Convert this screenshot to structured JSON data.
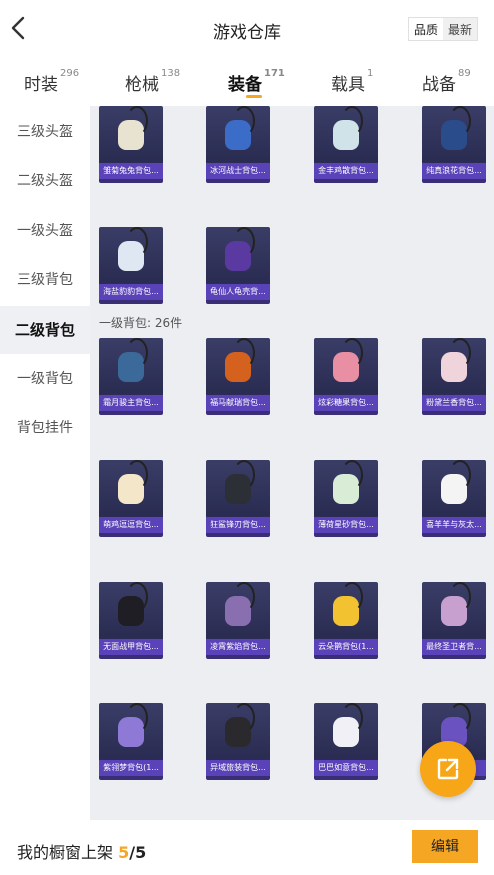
{
  "header": {
    "title": "游戏仓库",
    "sort_quality": "品质",
    "sort_newest": "最新"
  },
  "tabs": [
    {
      "label": "时装",
      "count": "296"
    },
    {
      "label": "枪械",
      "count": "138"
    },
    {
      "label": "装备",
      "count": "171"
    },
    {
      "label": "载具",
      "count": "1"
    },
    {
      "label": "战备",
      "count": "89"
    }
  ],
  "active_tab": "装备",
  "sidebar": [
    {
      "label": "三级头盔"
    },
    {
      "label": "二级头盔"
    },
    {
      "label": "一级头盔"
    },
    {
      "label": "三级背包"
    },
    {
      "label": "二级背包"
    },
    {
      "label": "一级背包"
    },
    {
      "label": "背包挂件"
    }
  ],
  "active_sidebar": "二级背包",
  "section_level1": {
    "label": "一级背包: 26件"
  },
  "items_top": [
    {
      "name": "雏菊兔兔背包...",
      "color": "#e8e3d0"
    },
    {
      "name": "冰河战士背包...",
      "color": "#3a6cc8"
    },
    {
      "name": "金丰鸡散背包...",
      "color": "#cfe3e8"
    },
    {
      "name": "纯真浪花背包...",
      "color": "#2a4c8a"
    },
    {
      "name": "海盐豹豹背包...",
      "color": "#dfe8f2"
    },
    {
      "name": "龟仙人龟壳背...",
      "color": "#5a3aa0"
    }
  ],
  "items_level1": [
    {
      "name": "霜月骏主背包...",
      "color": "#3b6a9a"
    },
    {
      "name": "福马献瑞背包...",
      "color": "#d4621e"
    },
    {
      "name": "炫彩糖果背包...",
      "color": "#e88fa3"
    },
    {
      "name": "粉黛兰香背包...",
      "color": "#f0d4dc"
    },
    {
      "name": "萌鸡逗逗背包...",
      "color": "#f4e6c8"
    },
    {
      "name": "狂鲨锋刃背包...",
      "color": "#2d2f36"
    },
    {
      "name": "薄荷星砂背包...",
      "color": "#d8ecd6"
    },
    {
      "name": "喜羊羊与灰太...",
      "color": "#f4f4f4"
    },
    {
      "name": "无面战甲背包...",
      "color": "#1e1e24"
    },
    {
      "name": "凌霄紫焰背包...",
      "color": "#8a6fb0"
    },
    {
      "name": "云朵鹊背包(1...",
      "color": "#f2c230"
    },
    {
      "name": "最终圣卫者背...",
      "color": "#c8a0d0"
    },
    {
      "name": "紫翎梦背包(1...",
      "color": "#8e7ad6"
    },
    {
      "name": "异域旅装背包...",
      "color": "#2a2a2e"
    },
    {
      "name": "巴巴如意背包...",
      "color": "#f0f0f6"
    },
    {
      "name": "",
      "color": "#6a52c0"
    }
  ],
  "footer": {
    "label": "我的橱窗上架",
    "current": "5",
    "slash": "/",
    "total": "5",
    "edit_label": "编辑"
  },
  "colors": {
    "accent": "#f5a623",
    "card_label": "#5a43b8"
  },
  "icons": {
    "back": "chevron-left-icon",
    "fab": "share-external-icon"
  }
}
